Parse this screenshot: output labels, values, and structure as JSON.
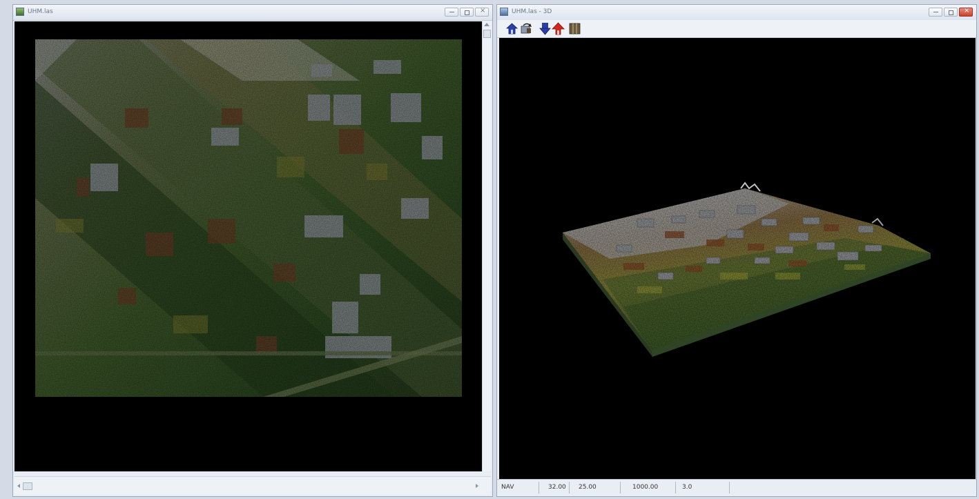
{
  "left_window": {
    "title": "UHM.las",
    "icon": "las-file-icon",
    "controls": [
      "minimize",
      "maximize",
      "close"
    ]
  },
  "right_window": {
    "title": "UHM.las - 3D",
    "icon": "3d-view-icon",
    "toolbar": [
      {
        "name": "home-view-icon",
        "color": "#2c3fa8"
      },
      {
        "name": "rotate-view-icon",
        "color": "#4a5a7a"
      },
      {
        "name": "move-down-icon",
        "color": "#2c3fa8"
      },
      {
        "name": "up-arrow-red-icon",
        "color": "#d0281e"
      },
      {
        "name": "grid-pattern-icon",
        "color": "#6b5b3d"
      }
    ],
    "status": {
      "mode": "NAV",
      "v1": "32.00",
      "v2": "25.00",
      "v3": "1000.00",
      "v4": "3.0"
    }
  }
}
